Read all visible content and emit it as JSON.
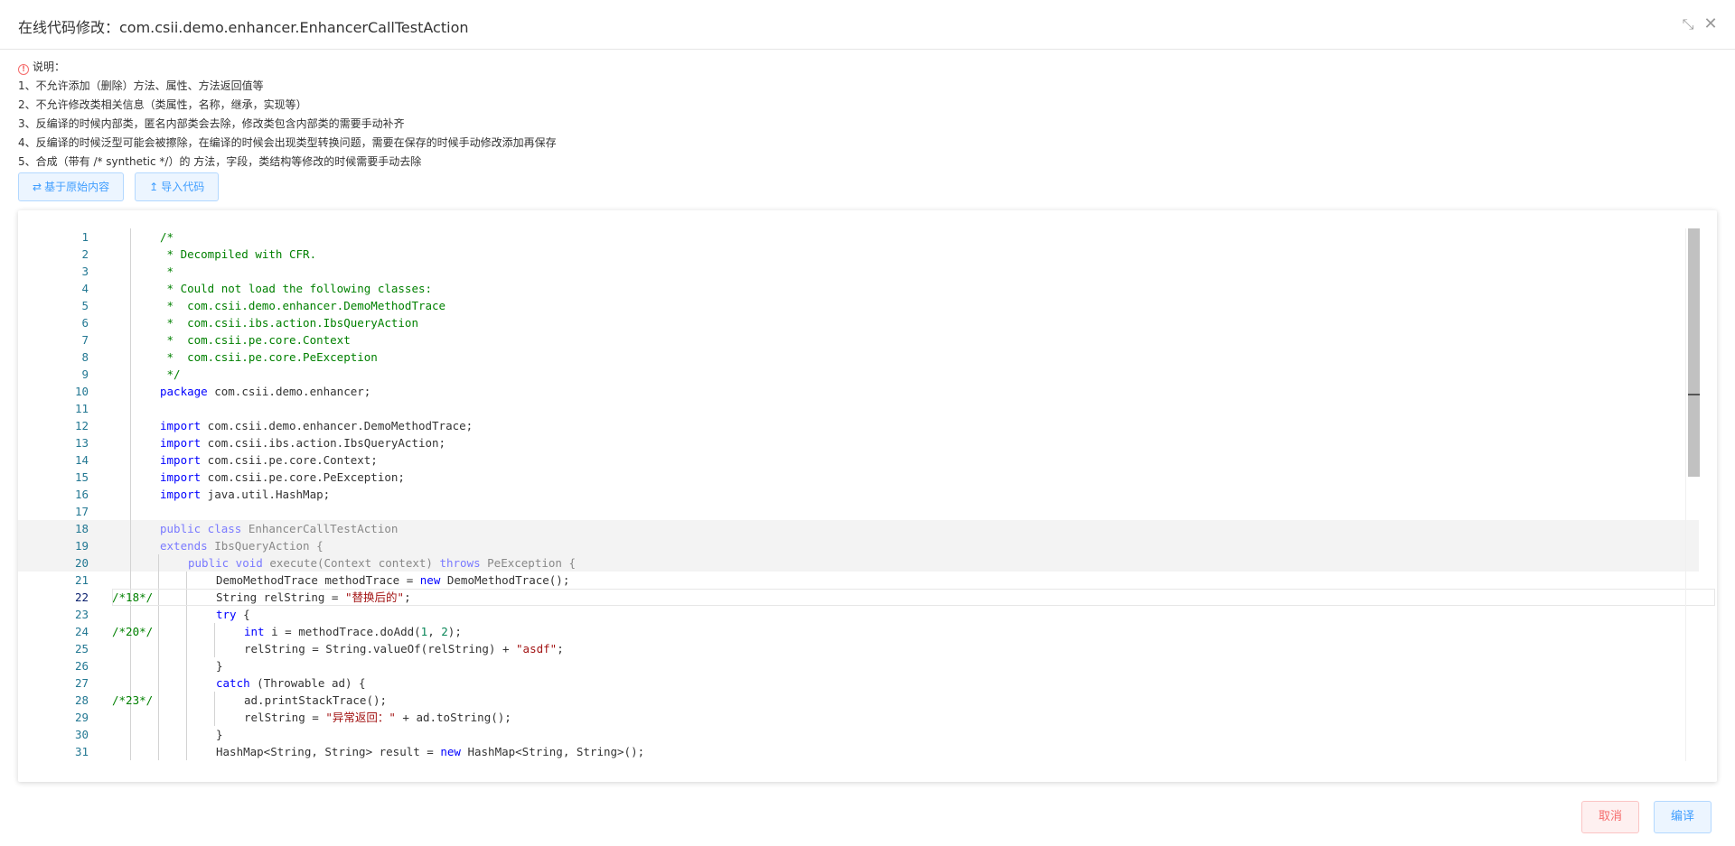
{
  "dialog": {
    "title": "在线代码修改：com.csii.demo.enhancer.EnhancerCallTestAction",
    "shrink_icon": "shrink-icon",
    "close_icon": "close-icon"
  },
  "notes": {
    "icon": "info-circle-icon",
    "title": "说明：",
    "lines": [
      "1、不允许添加（删除）方法、属性、方法返回值等",
      "2、不允许修改类相关信息（类属性，名称，继承，实现等）",
      "3、反编译的时候内部类，匿名内部类会去除，修改类包含内部类的需要手动补齐",
      "4、反编译的时候泛型可能会被擦除，在编译的时候会出现类型转换问题，需要在保存的时候手动修改添加再保存",
      "5、合成（带有 /* synthetic */）的 方法，字段，类结构等修改的时候需要手动去除"
    ]
  },
  "toolbar": {
    "based_on_original_label": "基于原始内容",
    "based_on_original_icon": "swap-arrows-icon",
    "import_code_label": "导入代码",
    "import_code_icon": "upload-icon"
  },
  "editor": {
    "current_line": 22,
    "lines": [
      {
        "n": 1,
        "g": "",
        "ind": 0,
        "html": "<span class=\"cm\">/*</span>"
      },
      {
        "n": 2,
        "g": "",
        "ind": 0,
        "html": "<span class=\"cm\"> * Decompiled with CFR.</span>"
      },
      {
        "n": 3,
        "g": "",
        "ind": 0,
        "html": "<span class=\"cm\"> *</span>"
      },
      {
        "n": 4,
        "g": "",
        "ind": 0,
        "html": "<span class=\"cm\"> * Could not load the following classes:</span>"
      },
      {
        "n": 5,
        "g": "",
        "ind": 0,
        "html": "<span class=\"cm\"> *  com.csii.demo.enhancer.DemoMethodTrace</span>"
      },
      {
        "n": 6,
        "g": "",
        "ind": 0,
        "html": "<span class=\"cm\"> *  com.csii.ibs.action.IbsQueryAction</span>"
      },
      {
        "n": 7,
        "g": "",
        "ind": 0,
        "html": "<span class=\"cm\"> *  com.csii.pe.core.Context</span>"
      },
      {
        "n": 8,
        "g": "",
        "ind": 0,
        "html": "<span class=\"cm\"> *  com.csii.pe.core.PeException</span>"
      },
      {
        "n": 9,
        "g": "",
        "ind": 0,
        "html": "<span class=\"cm\"> */</span>"
      },
      {
        "n": 10,
        "g": "",
        "ind": 0,
        "html": "<span class=\"kw\">package</span> com.csii.demo.enhancer;"
      },
      {
        "n": 11,
        "g": "",
        "ind": 0,
        "html": ""
      },
      {
        "n": 12,
        "g": "",
        "ind": 0,
        "html": "<span class=\"kw\">import</span> com.csii.demo.enhancer.DemoMethodTrace;"
      },
      {
        "n": 13,
        "g": "",
        "ind": 0,
        "html": "<span class=\"kw\">import</span> com.csii.ibs.action.IbsQueryAction;"
      },
      {
        "n": 14,
        "g": "",
        "ind": 0,
        "html": "<span class=\"kw\">import</span> com.csii.pe.core.Context;"
      },
      {
        "n": 15,
        "g": "",
        "ind": 0,
        "html": "<span class=\"kw\">import</span> com.csii.pe.core.PeException;"
      },
      {
        "n": 16,
        "g": "",
        "ind": 0,
        "html": "<span class=\"kw\">import</span> java.util.HashMap;"
      },
      {
        "n": 17,
        "g": "",
        "ind": 0,
        "html": ""
      },
      {
        "n": 18,
        "g": "",
        "ind": 0,
        "hl": true,
        "html": "<span class=\"faded\"><span class=\"kw\">public class</span> EnhancerCallTestAction</span>"
      },
      {
        "n": 19,
        "g": "",
        "ind": 0,
        "hl": true,
        "html": "<span class=\"faded\"><span class=\"kw\">extends</span> IbsQueryAction {</span>"
      },
      {
        "n": 20,
        "g": "",
        "ind": 1,
        "hl": true,
        "html": "<span class=\"faded\"><span class=\"kw\">public void</span> execute(Context context) <span class=\"kw\">throws</span> PeException {</span>"
      },
      {
        "n": 21,
        "g": "",
        "ind": 2,
        "html": "DemoMethodTrace methodTrace = <span class=\"kw\">new</span> DemoMethodTrace();"
      },
      {
        "n": 22,
        "g": "/*18*/",
        "ind": 2,
        "html": "String relString = <span class=\"str\">\"替换后的\"</span>;"
      },
      {
        "n": 23,
        "g": "",
        "ind": 2,
        "html": "<span class=\"kw\">try</span> {"
      },
      {
        "n": 24,
        "g": "/*20*/",
        "ind": 3,
        "html": "<span class=\"kw\">int</span> i = methodTrace.doAdd(<span class=\"num\">1</span>, <span class=\"num\">2</span>);"
      },
      {
        "n": 25,
        "g": "",
        "ind": 3,
        "html": "relString = String.valueOf(relString) + <span class=\"str\">\"asdf\"</span>;"
      },
      {
        "n": 26,
        "g": "",
        "ind": 2,
        "html": "}"
      },
      {
        "n": 27,
        "g": "",
        "ind": 2,
        "html": "<span class=\"kw\">catch</span> (Throwable ad) {"
      },
      {
        "n": 28,
        "g": "/*23*/",
        "ind": 3,
        "html": "ad.printStackTrace();"
      },
      {
        "n": 29,
        "g": "",
        "ind": 3,
        "html": "relString = <span class=\"str\">\"异常返回：\"</span> + ad.toString();"
      },
      {
        "n": 30,
        "g": "",
        "ind": 2,
        "html": "}"
      },
      {
        "n": 31,
        "g": "",
        "ind": 2,
        "html": "HashMap&lt;String, String&gt; result = <span class=\"kw\">new</span> HashMap&lt;String, String&gt;();"
      }
    ]
  },
  "footer": {
    "cancel_label": "取消",
    "compile_label": "编译"
  }
}
